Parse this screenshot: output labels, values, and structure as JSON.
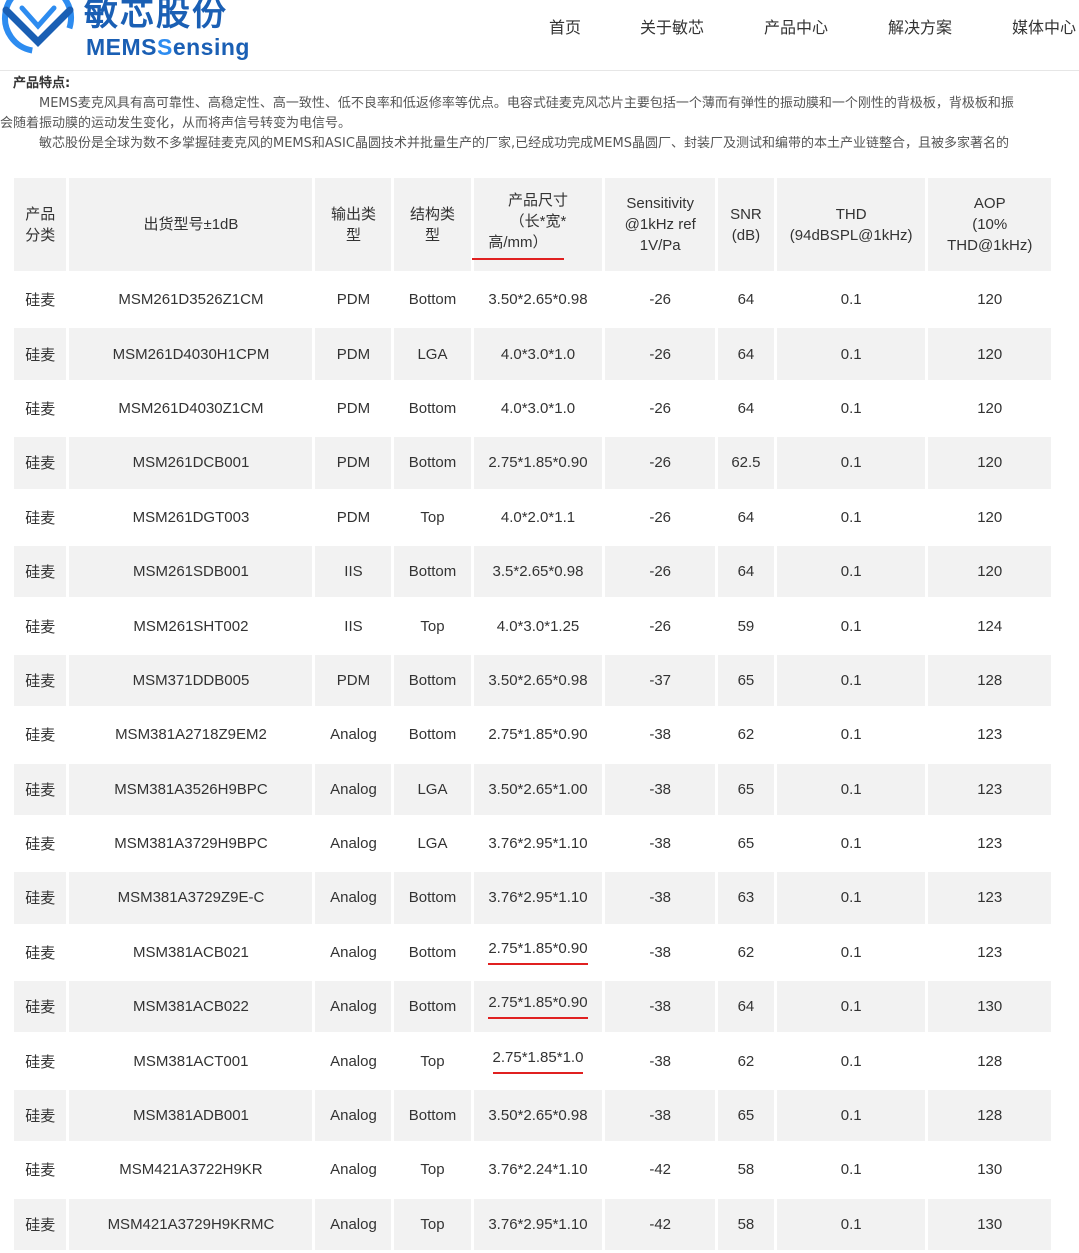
{
  "brand": {
    "cn": "敏芯股份",
    "en_part1": "MEMS",
    "en_part2": "ensing",
    "en_s": "S"
  },
  "nav": [
    "首页",
    "关于敏芯",
    "产品中心",
    "解决方案",
    "媒体中心"
  ],
  "intro": {
    "title": "产品特点:",
    "line1": "MEMS麦克风具有高可靠性、高稳定性、高一致性、低不良率和低返修率等优点。电容式硅麦克风芯片主要包括一个薄而有弹性的振动膜和一个刚性的背极板，背极板和振",
    "line2": "会随着振动膜的运动发生变化，从而将声信号转变为电信号。",
    "line3": "敏芯股份是全球为数不多掌握硅麦克风的MEMS和ASIC晶圆技术并批量生产的厂家,已经成功完成MEMS晶圆厂、封装厂及测试和编带的本土产业链整合，且被多家著名的"
  },
  "table": {
    "headers": {
      "category": "产品分类",
      "model": "出货型号±1dB",
      "output": "输出类型",
      "structure": "结构类型",
      "size": "产品尺寸(长*宽*高/mm)",
      "sensitivity": "Sensitivity @1kHz ref 1V/Pa",
      "snr": "SNR (dB)",
      "thd": "THD (94dBSPL@1kHz)",
      "aop": "AOP (10% THD@1kHz)"
    },
    "header_lines": {
      "category": [
        "产品",
        "分类"
      ],
      "output": [
        "输出类",
        "型"
      ],
      "structure": [
        "结构类",
        "型"
      ],
      "size": [
        "产品尺寸",
        "（长*宽*",
        "高/mm）"
      ],
      "sensitivity": [
        "Sensitivity",
        "@1kHz ref",
        "1V/Pa"
      ],
      "snr": [
        "SNR",
        "(dB)"
      ],
      "thd": [
        "THD",
        "(94dBSPL@1kHz)"
      ],
      "aop": [
        "AOP",
        "(10%",
        "THD@1kHz)"
      ]
    },
    "rows": [
      {
        "category": "硅麦",
        "model": "MSM261D3526Z1CM",
        "output": "PDM",
        "structure": "Bottom",
        "size": "3.50*2.65*0.98",
        "sensitivity": "-26",
        "snr": "64",
        "thd": "0.1",
        "aop": "120",
        "size_underlined": false
      },
      {
        "category": "硅麦",
        "model": "MSM261D4030H1CPM",
        "output": "PDM",
        "structure": "LGA",
        "size": "4.0*3.0*1.0",
        "sensitivity": "-26",
        "snr": "64",
        "thd": "0.1",
        "aop": "120",
        "size_underlined": false
      },
      {
        "category": "硅麦",
        "model": "MSM261D4030Z1CM",
        "output": "PDM",
        "structure": "Bottom",
        "size": "4.0*3.0*1.0",
        "sensitivity": "-26",
        "snr": "64",
        "thd": "0.1",
        "aop": "120",
        "size_underlined": false
      },
      {
        "category": "硅麦",
        "model": "MSM261DCB001",
        "output": "PDM",
        "structure": "Bottom",
        "size": "2.75*1.85*0.90",
        "sensitivity": "-26",
        "snr": "62.5",
        "thd": "0.1",
        "aop": "120",
        "size_underlined": false
      },
      {
        "category": "硅麦",
        "model": "MSM261DGT003",
        "output": "PDM",
        "structure": "Top",
        "size": "4.0*2.0*1.1",
        "sensitivity": "-26",
        "snr": "64",
        "thd": "0.1",
        "aop": "120",
        "size_underlined": false
      },
      {
        "category": "硅麦",
        "model": "MSM261SDB001",
        "output": "IIS",
        "structure": "Bottom",
        "size": "3.5*2.65*0.98",
        "sensitivity": "-26",
        "snr": "64",
        "thd": "0.1",
        "aop": "120",
        "size_underlined": false
      },
      {
        "category": "硅麦",
        "model": "MSM261SHT002",
        "output": "IIS",
        "structure": "Top",
        "size": "4.0*3.0*1.25",
        "sensitivity": "-26",
        "snr": "59",
        "thd": "0.1",
        "aop": "124",
        "size_underlined": false
      },
      {
        "category": "硅麦",
        "model": "MSM371DDB005",
        "output": "PDM",
        "structure": "Bottom",
        "size": "3.50*2.65*0.98",
        "sensitivity": "-37",
        "snr": "65",
        "thd": "0.1",
        "aop": "128",
        "size_underlined": false
      },
      {
        "category": "硅麦",
        "model": "MSM381A2718Z9EM2",
        "output": "Analog",
        "structure": "Bottom",
        "size": "2.75*1.85*0.90",
        "sensitivity": "-38",
        "snr": "62",
        "thd": "0.1",
        "aop": "123",
        "size_underlined": false
      },
      {
        "category": "硅麦",
        "model": "MSM381A3526H9BPC",
        "output": "Analog",
        "structure": "LGA",
        "size": "3.50*2.65*1.00",
        "sensitivity": "-38",
        "snr": "65",
        "thd": "0.1",
        "aop": "123",
        "size_underlined": false
      },
      {
        "category": "硅麦",
        "model": "MSM381A3729H9BPC",
        "output": "Analog",
        "structure": "LGA",
        "size": "3.76*2.95*1.10",
        "sensitivity": "-38",
        "snr": "65",
        "thd": "0.1",
        "aop": "123",
        "size_underlined": false
      },
      {
        "category": "硅麦",
        "model": "MSM381A3729Z9E-C",
        "output": "Analog",
        "structure": "Bottom",
        "size": "3.76*2.95*1.10",
        "sensitivity": "-38",
        "snr": "63",
        "thd": "0.1",
        "aop": "123",
        "size_underlined": false
      },
      {
        "category": "硅麦",
        "model": "MSM381ACB021",
        "output": "Analog",
        "structure": "Bottom",
        "size": "2.75*1.85*0.90",
        "sensitivity": "-38",
        "snr": "62",
        "thd": "0.1",
        "aop": "123",
        "size_underlined": true
      },
      {
        "category": "硅麦",
        "model": "MSM381ACB022",
        "output": "Analog",
        "structure": "Bottom",
        "size": "2.75*1.85*0.90",
        "sensitivity": "-38",
        "snr": "64",
        "thd": "0.1",
        "aop": "130",
        "size_underlined": true
      },
      {
        "category": "硅麦",
        "model": "MSM381ACT001",
        "output": "Analog",
        "structure": "Top",
        "size": "2.75*1.85*1.0",
        "sensitivity": "-38",
        "snr": "62",
        "thd": "0.1",
        "aop": "128",
        "size_underlined": true
      },
      {
        "category": "硅麦",
        "model": "MSM381ADB001",
        "output": "Analog",
        "structure": "Bottom",
        "size": "3.50*2.65*0.98",
        "sensitivity": "-38",
        "snr": "65",
        "thd": "0.1",
        "aop": "128",
        "size_underlined": false
      },
      {
        "category": "硅麦",
        "model": "MSM421A3722H9KR",
        "output": "Analog",
        "structure": "Top",
        "size": "3.76*2.24*1.10",
        "sensitivity": "-42",
        "snr": "58",
        "thd": "0.1",
        "aop": "130",
        "size_underlined": false
      },
      {
        "category": "硅麦",
        "model": "MSM421A3729H9KRMC",
        "output": "Analog",
        "structure": "Top",
        "size": "3.76*2.95*1.10",
        "sensitivity": "-42",
        "snr": "58",
        "thd": "0.1",
        "aop": "130",
        "size_underlined": false
      }
    ]
  },
  "colors": {
    "brand": "#1a5fb4",
    "brand_light": "#2d8cf0",
    "row_alt": "#f2f2f2",
    "annotation": "#e02020"
  }
}
